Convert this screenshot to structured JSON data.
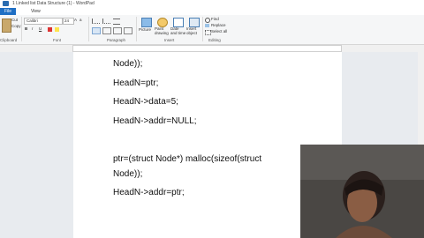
{
  "window": {
    "title": "1 Linked list Data Structure (1) - WordPad"
  },
  "tabs": [
    "File",
    "Home",
    "View"
  ],
  "ribbon": {
    "clipboard": {
      "cut": "Cut",
      "copy": "Copy",
      "paste": "Paste",
      "label": "Clipboard"
    },
    "font": {
      "family": "Calibri",
      "size": "24",
      "label": "Font"
    },
    "paragraph": {
      "label": "Paragraph"
    },
    "insert": {
      "picture": "Picture",
      "paint": "Paint drawing",
      "datetime": "Date and time",
      "object": "Insert object",
      "label": "Insert"
    },
    "editing": {
      "find": "Find",
      "replace": "Replace",
      "select_all": "Select all",
      "label": "Editing"
    }
  },
  "document": {
    "lines": [
      "Node));",
      "HeadN=ptr;",
      "HeadN->data=5;",
      "HeadN->addr=NULL;",
      "ptr=(struct Node*) malloc(sizeof(struct",
      "Node));",
      "HeadN->addr=ptr;"
    ]
  }
}
